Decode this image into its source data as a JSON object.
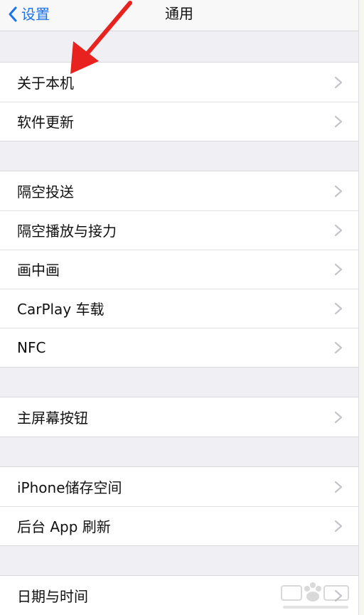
{
  "navbar": {
    "back_label": "设置",
    "title": "通用"
  },
  "groups": [
    {
      "items": [
        {
          "label": "关于本机"
        },
        {
          "label": "软件更新"
        }
      ]
    },
    {
      "items": [
        {
          "label": "隔空投送"
        },
        {
          "label": "隔空播放与接力"
        },
        {
          "label": "画中画"
        },
        {
          "label": "CarPlay 车载"
        },
        {
          "label": "NFC"
        }
      ]
    },
    {
      "items": [
        {
          "label": "主屏幕按钮"
        }
      ]
    },
    {
      "items": [
        {
          "label": "iPhone储存空间"
        },
        {
          "label": "后台 App 刷新"
        }
      ]
    },
    {
      "items": [
        {
          "label": "日期与时间"
        }
      ]
    }
  ],
  "colors": {
    "accent": "#1a73e8",
    "annotation": "#e8231f",
    "chevron": "#c4c4c9"
  },
  "icons": {
    "back": "chevron-left-icon",
    "disclosure": "chevron-right-icon"
  }
}
